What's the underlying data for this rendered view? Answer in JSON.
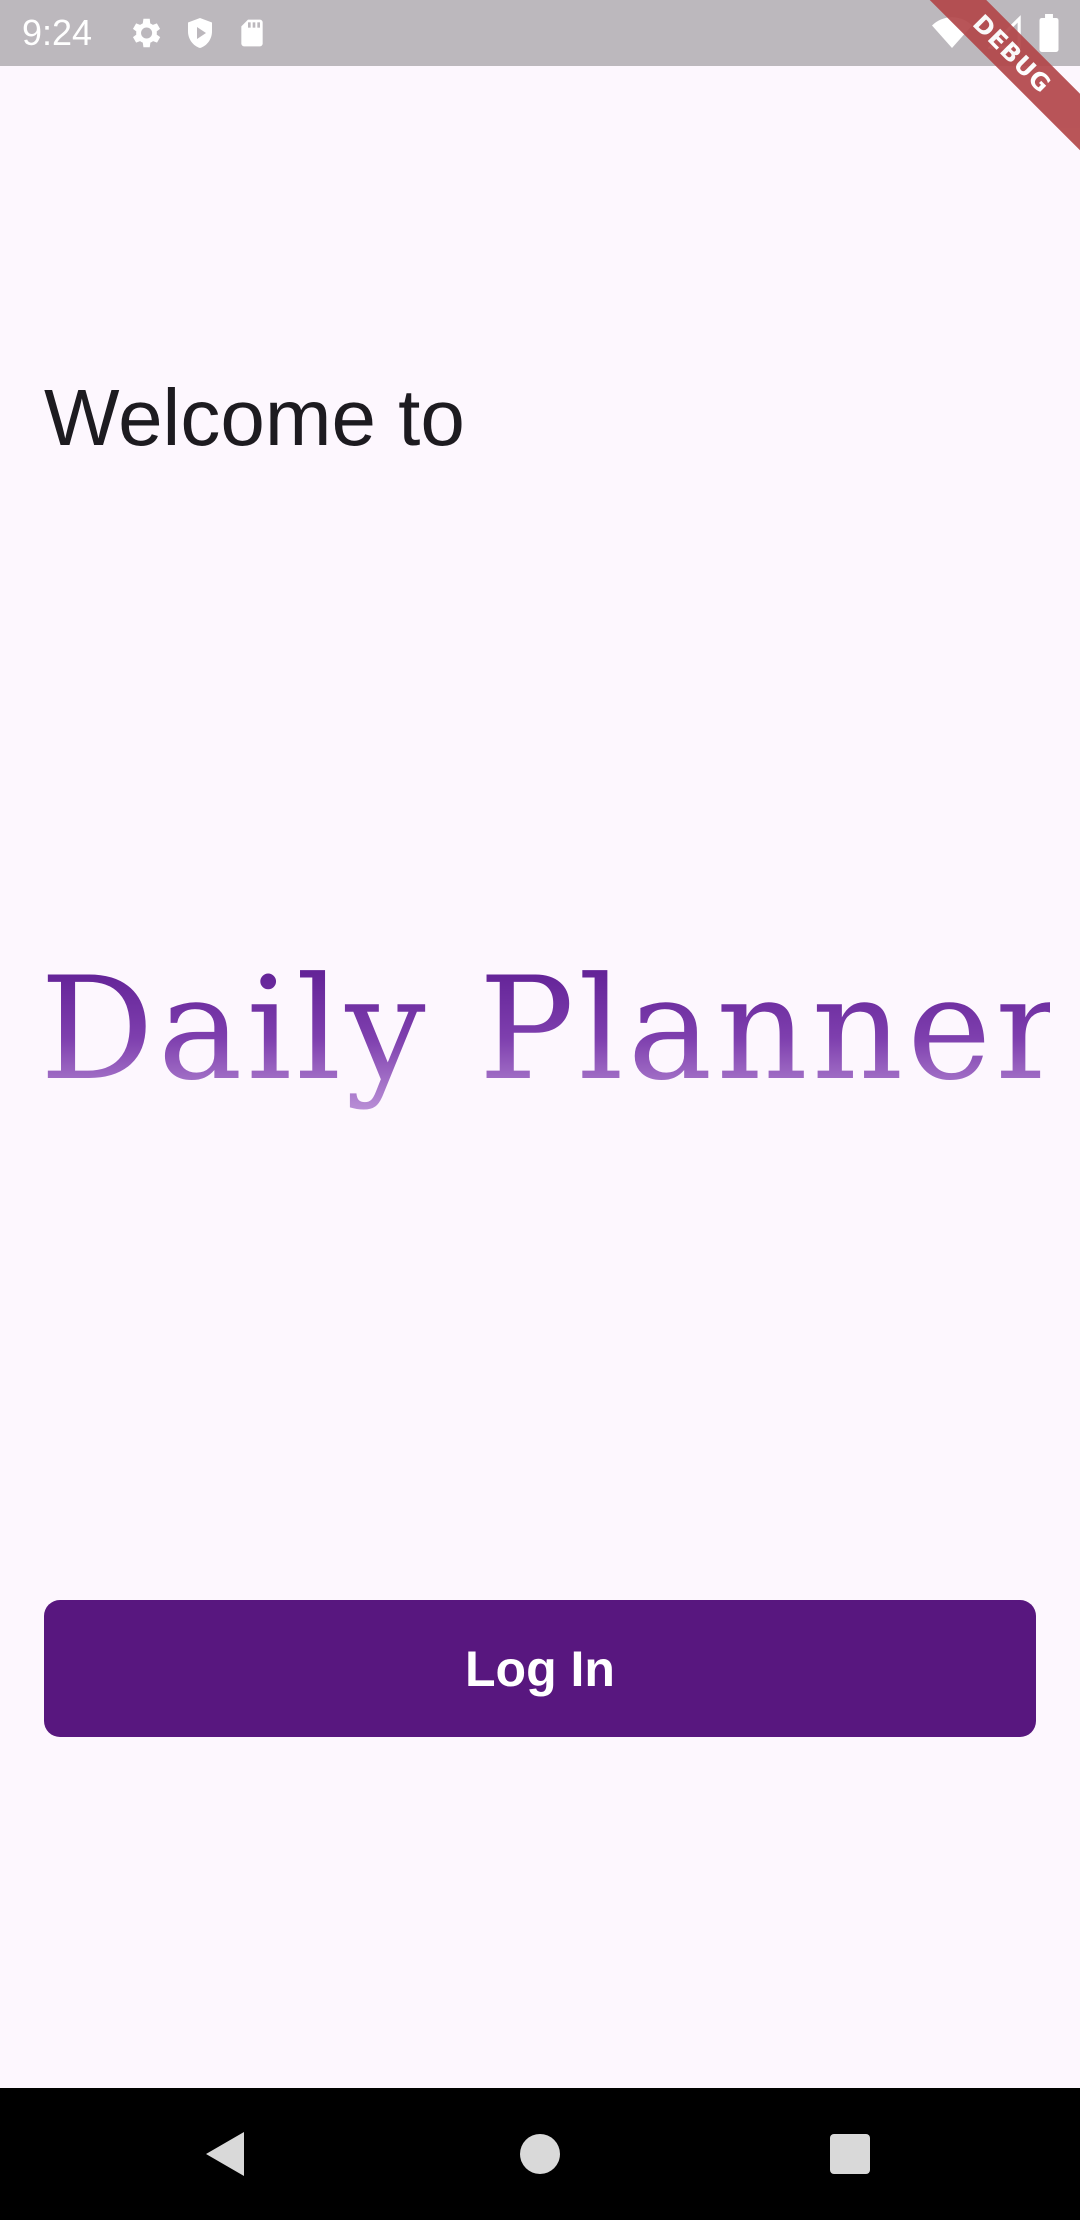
{
  "status_bar": {
    "time": "9:24",
    "icons_left": [
      "settings-icon",
      "shield-play-icon",
      "sd-card-icon"
    ],
    "icons_right": [
      "wifi-icon",
      "signal-icon",
      "battery-icon"
    ],
    "background": "#bcb8bd"
  },
  "debug_banner": {
    "label": "DEBUG",
    "color": "#b3474a"
  },
  "main": {
    "welcome_text": "Welcome to",
    "app_logo_text": "Daily Planner",
    "login_button_label": "Log In",
    "accent_color": "#58177f",
    "background": "#fdf7fe"
  },
  "nav_bar": {
    "buttons": [
      "back-icon",
      "home-icon",
      "recents-icon"
    ]
  }
}
